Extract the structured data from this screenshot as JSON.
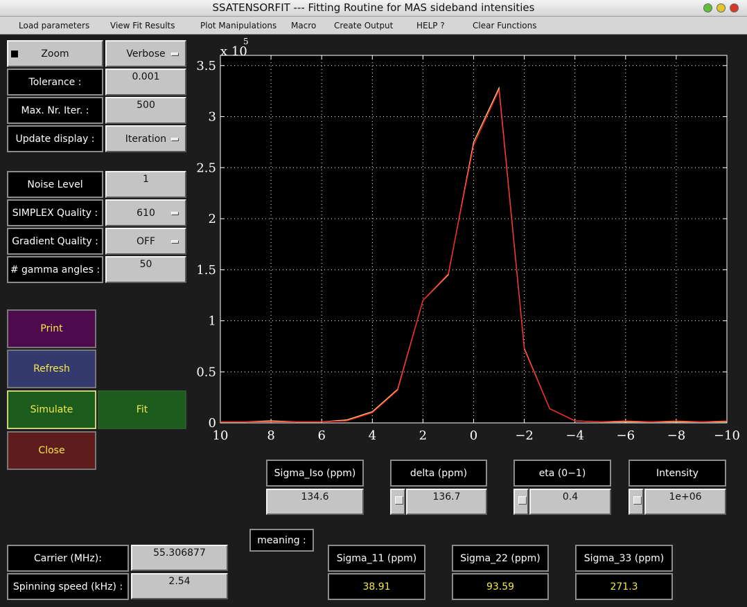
{
  "window": {
    "title": "SSATENSORFIT --- Fitting Routine for MAS sideband intensities"
  },
  "menu": [
    "Load parameters",
    "View Fit Results",
    "Plot Manipulations",
    "Macro",
    "Create Output",
    "HELP ?",
    "Clear Functions"
  ],
  "controls": {
    "zoom_label": "Zoom",
    "verbose_label": "Verbose",
    "tolerance_label": "Tolerance :",
    "tolerance_value": "0.001",
    "max_iter_label": "Max. Nr. Iter. :",
    "max_iter_value": "500",
    "update_display_label": "Update display :",
    "update_display_value": "Iteration",
    "noise_level_label": "Noise Level",
    "noise_level_value": "1",
    "simplex_quality_label": "SIMPLEX Quality :",
    "simplex_quality_value": "610",
    "gradient_quality_label": "Gradient Quality :",
    "gradient_quality_value": "OFF",
    "gamma_angles_label": "# gamma angles :",
    "gamma_angles_value": "50"
  },
  "actions": {
    "print": "Print",
    "refresh": "Refresh",
    "simulate": "Simulate",
    "fit": "Fit",
    "close": "Close"
  },
  "params": {
    "sigma_iso_label": "Sigma_Iso (ppm)",
    "sigma_iso_value": "134.6",
    "delta_label": "delta (ppm)",
    "delta_value": "136.7",
    "eta_label": "eta (0−1)",
    "eta_value": "0.4",
    "intensity_label": "Intensity",
    "intensity_value": "1e+06"
  },
  "meaning_label": "meaning :",
  "carrier": {
    "carrier_label": "Carrier (MHz):",
    "carrier_value": "55.306877",
    "spinning_label": "Spinning speed (kHz) :",
    "spinning_value": "2.54"
  },
  "tensor": {
    "s11_label": "Sigma_11 (ppm)",
    "s11_value": "38.91",
    "s22_label": "Sigma_22 (ppm)",
    "s22_value": "93.59",
    "s33_label": "Sigma_33 (ppm)",
    "s33_value": "271.3"
  },
  "colors": {
    "print_bg": "#4d0a4d",
    "refresh_bg": "#353a6e",
    "simulate_bg": "#1c5c1c",
    "fit_bg": "#1c5c1c",
    "close_bg": "#5e1c1c",
    "trace_experimental": "#ffd27a",
    "trace_simulated": "#ff2020"
  },
  "chart_data": {
    "type": "line",
    "title": "",
    "xlabel": "",
    "ylabel": "",
    "y_multiplier_label": "x 10",
    "y_multiplier_exponent": "5",
    "xlim": [
      10,
      -10
    ],
    "ylim": [
      0,
      3.6
    ],
    "x_ticks": [
      10,
      8,
      6,
      4,
      2,
      0,
      -2,
      -4,
      -6,
      -8,
      -10
    ],
    "x_tick_labels": [
      "10",
      "8",
      "6",
      "4",
      "2",
      "0",
      "−2",
      "−4",
      "−6",
      "−8",
      "−10"
    ],
    "y_ticks": [
      0,
      0.5,
      1,
      1.5,
      2,
      2.5,
      3,
      3.5
    ],
    "y_tick_labels": [
      "0",
      "0.5",
      "1",
      "1.5",
      "2",
      "2.5",
      "3",
      "3.5"
    ],
    "grid": true,
    "x": [
      10,
      9,
      8,
      7,
      6,
      5,
      4,
      3,
      2,
      1,
      0,
      -1,
      -2,
      -3,
      -4,
      -5,
      -6,
      -7,
      -8,
      -9,
      -10
    ],
    "series": [
      {
        "values": [
          0.01,
          0.01,
          0.02,
          0.01,
          0.01,
          0.03,
          0.11,
          0.33,
          1.2,
          1.45,
          2.75,
          3.28,
          0.73,
          0.14,
          0.02,
          0.01,
          0.01,
          0.01,
          0.01,
          0.01,
          0.01
        ]
      },
      {
        "values": [
          0.01,
          0.01,
          0.01,
          0.01,
          0.01,
          0.02,
          0.1,
          0.32,
          1.2,
          1.46,
          2.72,
          3.26,
          0.72,
          0.14,
          0.02,
          0.01,
          0.02,
          0.01,
          0.02,
          0.01,
          0.02
        ]
      }
    ]
  }
}
